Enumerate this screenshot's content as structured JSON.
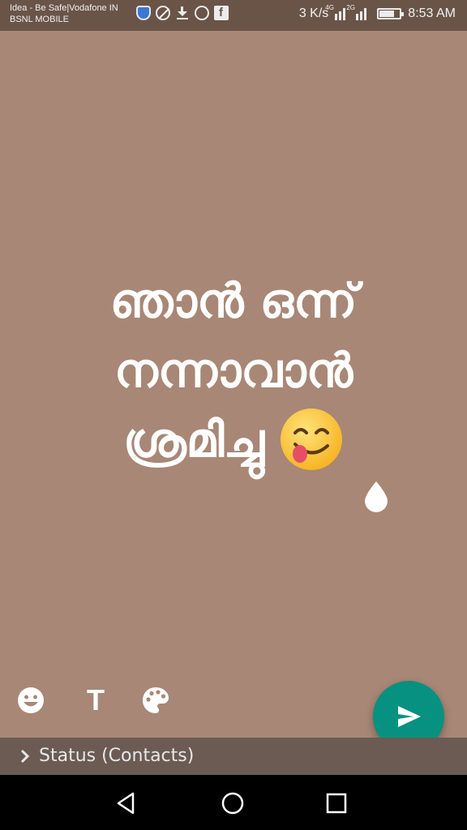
{
  "statusbar": {
    "carrier1": "Idea - Be Safe|Vodafone IN",
    "carrier2": "BSNL MOBILE",
    "speed": "3 K/s",
    "net1": "4G",
    "net2": "2G",
    "time": "8:53 AM"
  },
  "status_text": {
    "line1": "ഞാൻ ഒന്ന്",
    "line2": "നന്നാവാൻ",
    "line3": "ശ്രമിച്ചു"
  },
  "audience": {
    "label": "Status (Contacts)"
  },
  "icons": {
    "emoji_in_text": "face-savoring-food-emoji",
    "drop": "ink-drop-icon",
    "emoji_tool": "emoji-icon",
    "text_tool": "text-icon",
    "palette_tool": "palette-icon",
    "send": "send-icon",
    "chevron": "chevron-right-icon",
    "nav_back": "back-icon",
    "nav_home": "home-icon",
    "nav_recent": "recent-apps-icon"
  },
  "text_tool_label": "T",
  "colors": {
    "background": "#a88776",
    "fab": "#079180",
    "audience_bar": "#6b5b53"
  }
}
